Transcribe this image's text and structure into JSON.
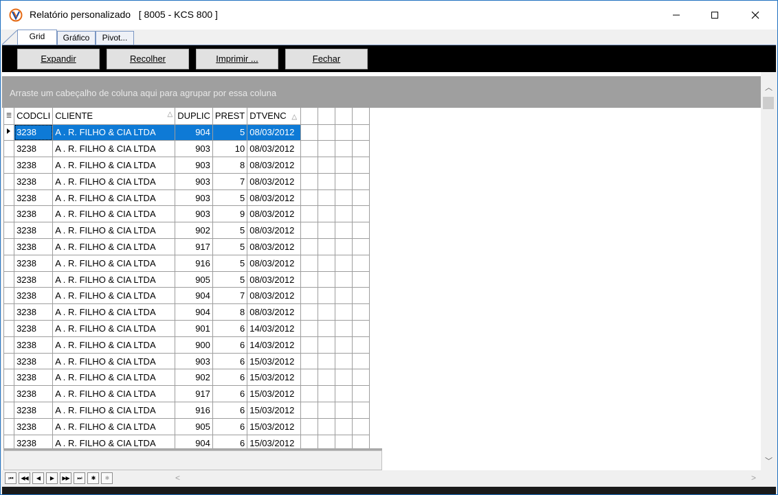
{
  "window": {
    "title": "Relatório personalizado   [ 8005 - KCS 800 ]",
    "controls": {
      "minimize": "minimize-icon",
      "maximize": "maximize-icon",
      "close": "close-icon"
    }
  },
  "tabs": [
    {
      "label": "Grid",
      "active": true
    },
    {
      "label": "Gráfico",
      "active": false
    },
    {
      "label": "Pivot...",
      "active": false
    }
  ],
  "toolbar": {
    "expand": {
      "accel": "E",
      "rest": "xpandir"
    },
    "collapse": {
      "accel": "R",
      "rest": "ecolher"
    },
    "print": {
      "accel": "I",
      "rest": "mprimir ..."
    },
    "close": {
      "accel": "F",
      "rest": "echar"
    }
  },
  "group_panel": {
    "hint": "Arraste um cabeçalho de coluna aqui para agrupar por essa coluna"
  },
  "grid": {
    "columns": [
      "CODCLI",
      "CLIENTE",
      "DUPLIC",
      "PREST",
      "DTVENC"
    ],
    "sort_icons": {
      "CLIENTE": "△",
      "DTVENC": "△"
    },
    "selected_row": 0,
    "rows": [
      [
        "3238",
        "A . R.  FILHO & CIA LTDA",
        "904",
        "5",
        "08/03/2012"
      ],
      [
        "3238",
        "A . R.  FILHO & CIA LTDA",
        "903",
        "10",
        "08/03/2012"
      ],
      [
        "3238",
        "A . R.  FILHO & CIA LTDA",
        "903",
        "8",
        "08/03/2012"
      ],
      [
        "3238",
        "A . R.  FILHO & CIA LTDA",
        "903",
        "7",
        "08/03/2012"
      ],
      [
        "3238",
        "A . R.  FILHO & CIA LTDA",
        "903",
        "5",
        "08/03/2012"
      ],
      [
        "3238",
        "A . R.  FILHO & CIA LTDA",
        "903",
        "9",
        "08/03/2012"
      ],
      [
        "3238",
        "A . R.  FILHO & CIA LTDA",
        "902",
        "5",
        "08/03/2012"
      ],
      [
        "3238",
        "A . R.  FILHO & CIA LTDA",
        "917",
        "5",
        "08/03/2012"
      ],
      [
        "3238",
        "A . R.  FILHO & CIA LTDA",
        "916",
        "5",
        "08/03/2012"
      ],
      [
        "3238",
        "A . R.  FILHO & CIA LTDA",
        "905",
        "5",
        "08/03/2012"
      ],
      [
        "3238",
        "A . R.  FILHO & CIA LTDA",
        "904",
        "7",
        "08/03/2012"
      ],
      [
        "3238",
        "A . R.  FILHO & CIA LTDA",
        "904",
        "8",
        "08/03/2012"
      ],
      [
        "3238",
        "A . R.  FILHO & CIA LTDA",
        "901",
        "6",
        "14/03/2012"
      ],
      [
        "3238",
        "A . R.  FILHO & CIA LTDA",
        "900",
        "6",
        "14/03/2012"
      ],
      [
        "3238",
        "A . R.  FILHO & CIA LTDA",
        "903",
        "6",
        "15/03/2012"
      ],
      [
        "3238",
        "A . R.  FILHO & CIA LTDA",
        "902",
        "6",
        "15/03/2012"
      ],
      [
        "3238",
        "A . R.  FILHO & CIA LTDA",
        "917",
        "6",
        "15/03/2012"
      ],
      [
        "3238",
        "A . R.  FILHO & CIA LTDA",
        "916",
        "6",
        "15/03/2012"
      ],
      [
        "3238",
        "A . R.  FILHO & CIA LTDA",
        "905",
        "6",
        "15/03/2012"
      ],
      [
        "3238",
        "A . R.  FILHO & CIA LTDA",
        "904",
        "6",
        "15/03/2012"
      ]
    ]
  },
  "navigator": {
    "buttons": [
      {
        "name": "nav-first-page-icon",
        "glyph": "⏮",
        "enabled": true
      },
      {
        "name": "nav-prev-page-icon",
        "glyph": "◀◀",
        "enabled": true
      },
      {
        "name": "nav-prev-icon",
        "glyph": "◀",
        "enabled": true
      },
      {
        "name": "nav-next-icon",
        "glyph": "▶",
        "enabled": true
      },
      {
        "name": "nav-next-page-icon",
        "glyph": "▶▶",
        "enabled": true
      },
      {
        "name": "nav-last-page-icon",
        "glyph": "⏭",
        "enabled": true
      },
      {
        "name": "nav-insert-icon",
        "glyph": "✱",
        "enabled": true
      },
      {
        "name": "nav-refresh-icon",
        "glyph": "✱",
        "enabled": false
      }
    ]
  },
  "colors": {
    "selection": "#0e7ad6",
    "group_panel": "#9f9f9f",
    "toolbar": "#000000",
    "window_border": "#1e6fbf"
  }
}
